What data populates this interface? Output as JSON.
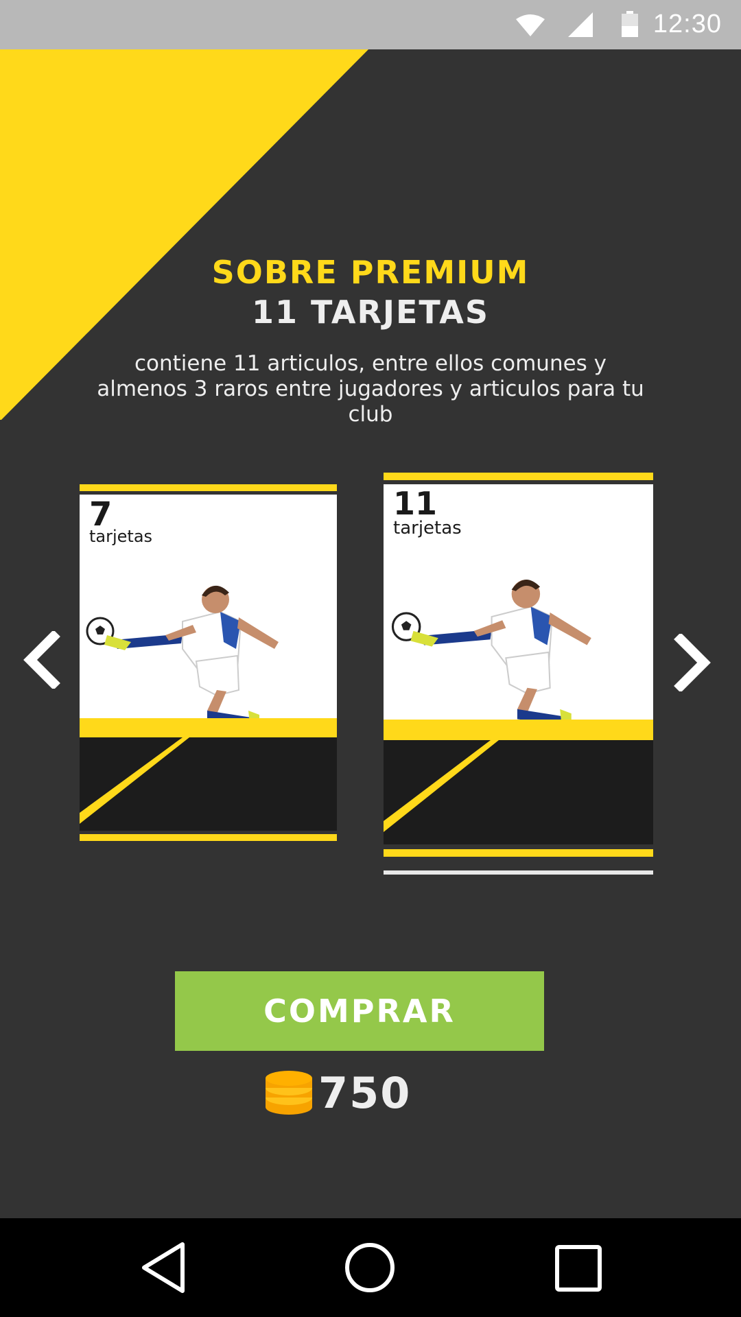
{
  "status_bar": {
    "time": "12:30",
    "icons": [
      "wifi-icon",
      "signal-icon",
      "battery-icon"
    ]
  },
  "pack": {
    "title": "SOBRE PREMIUM",
    "subtitle": "11 TARJETAS",
    "description": "contiene 11 articulos, entre ellos comunes y almenos 3 raros entre jugadores y articulos para tu club"
  },
  "cards": [
    {
      "count": "7",
      "label": "tarjetas"
    },
    {
      "count": "11",
      "label": "tarjetas"
    }
  ],
  "carousel": {
    "prev_icon": "chevron-left-icon",
    "next_icon": "chevron-right-icon",
    "selected_index": 1
  },
  "buy_button": {
    "label": "COMPRAR"
  },
  "price": {
    "amount": "750",
    "icon": "coins-icon"
  },
  "nav_bar": {
    "icons": [
      "back-icon",
      "home-icon",
      "recents-icon"
    ]
  },
  "colors": {
    "background": "#333333",
    "accent_yellow": "#FFD91A",
    "button_green": "#94C84A",
    "coin_orange": "#F7A300"
  }
}
